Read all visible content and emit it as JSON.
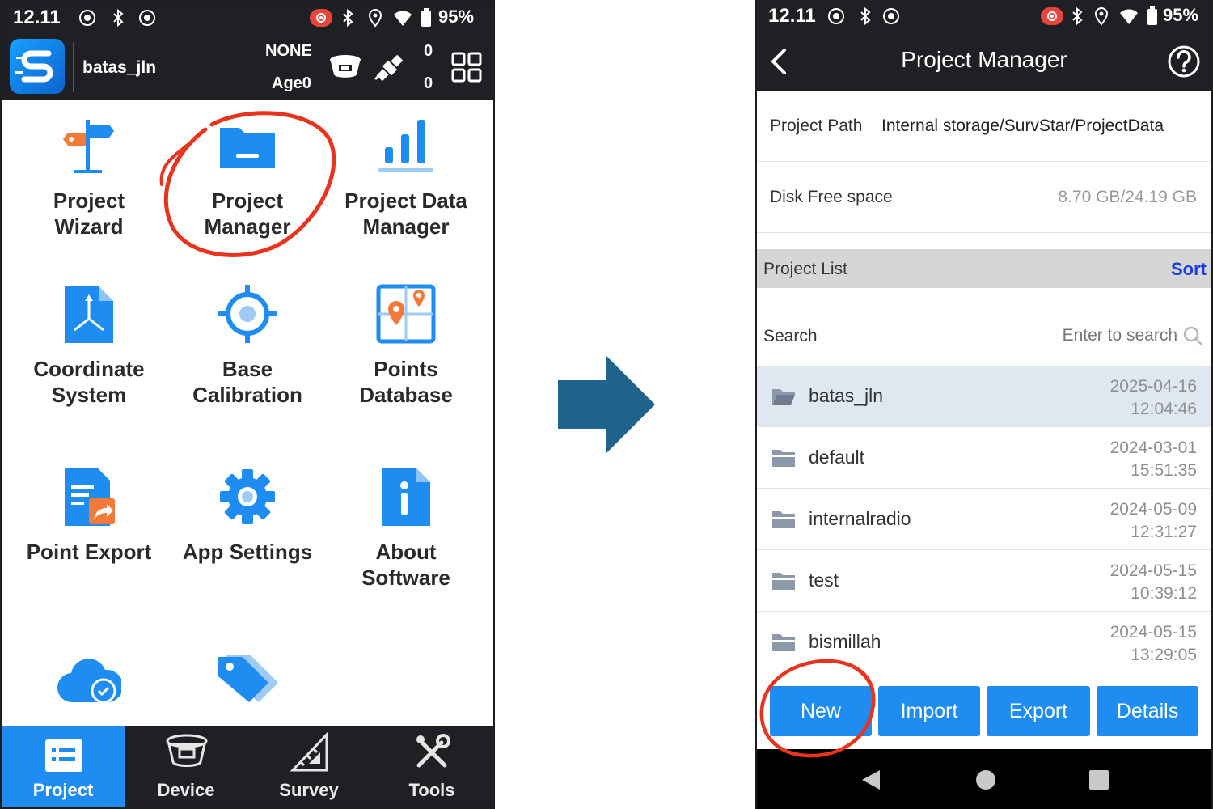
{
  "left": {
    "status": {
      "time": "12.11",
      "battery": "95%"
    },
    "header": {
      "project_name": "batas_jln",
      "solution": "NONE",
      "age": "Age0",
      "sats_top": "0",
      "sats_bottom": "0"
    },
    "grid": [
      {
        "label_1": "Project",
        "label_2": "Wizard"
      },
      {
        "label_1": "Project",
        "label_2": "Manager"
      },
      {
        "label_1": "Project Data",
        "label_2": "Manager"
      },
      {
        "label_1": "Coordinate",
        "label_2": "System"
      },
      {
        "label_1": "Base",
        "label_2": "Calibration"
      },
      {
        "label_1": "Points",
        "label_2": "Database"
      },
      {
        "label_1": "Point Export",
        "label_2": ""
      },
      {
        "label_1": "App Settings",
        "label_2": ""
      },
      {
        "label_1": "About",
        "label_2": "Software"
      }
    ],
    "nav": [
      {
        "label": "Project"
      },
      {
        "label": "Device"
      },
      {
        "label": "Survey"
      },
      {
        "label": "Tools"
      }
    ]
  },
  "right": {
    "status": {
      "time": "12.11",
      "battery": "95%"
    },
    "title": "Project Manager",
    "project_path_label": "Project Path",
    "project_path_value": "Internal storage/SurvStar/ProjectData",
    "disk_label": "Disk Free space",
    "disk_value": "8.70 GB/24.19 GB",
    "list_label": "Project List",
    "sort_label": "Sort",
    "search_label": "Search",
    "search_placeholder": "Enter to search",
    "projects": [
      {
        "name": "batas_jln",
        "date": "2025-04-16",
        "time": "12:04:46"
      },
      {
        "name": "default",
        "date": "2024-03-01",
        "time": "15:51:35"
      },
      {
        "name": "internalradio",
        "date": "2024-05-09",
        "time": "12:31:27"
      },
      {
        "name": "test",
        "date": "2024-05-15",
        "time": "10:39:12"
      },
      {
        "name": "bismillah",
        "date": "2024-05-15",
        "time": "13:29:05"
      }
    ],
    "buttons": {
      "new": "New",
      "import": "Import",
      "export": "Export",
      "details": "Details"
    }
  },
  "colors": {
    "accent": "#1e8cf1",
    "annotation": "#e8341f",
    "arrow": "#1f648c",
    "dark_bar": "#1f2023"
  }
}
